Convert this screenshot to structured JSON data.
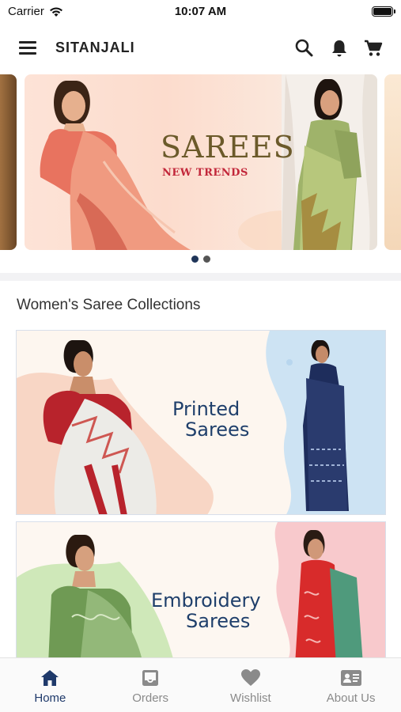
{
  "status_bar": {
    "carrier": "Carrier",
    "time": "10:07 AM"
  },
  "app_bar": {
    "title": "SITANJALI"
  },
  "banner": {
    "title": "SAREES",
    "subtitle": "NEW TRENDS",
    "active_slide": 1,
    "slide_count": 2,
    "dot_active_color": "#1f3559",
    "dot_inactive_color": "#555555"
  },
  "section": {
    "title": "Women's Saree Collections"
  },
  "collections": [
    {
      "line1": "Printed",
      "line2": "Sarees"
    },
    {
      "line1": "Embroidery",
      "line2": "Sarees"
    }
  ],
  "bottom_nav": {
    "items": [
      {
        "label": "Home",
        "icon": "home-icon",
        "active": true
      },
      {
        "label": "Orders",
        "icon": "inbox-icon",
        "active": false
      },
      {
        "label": "Wishlist",
        "icon": "heart-icon",
        "active": false
      },
      {
        "label": "About Us",
        "icon": "contact-card-icon",
        "active": false
      }
    ],
    "active_color": "#1f3a6b",
    "inactive_color": "#8a8a8a"
  }
}
